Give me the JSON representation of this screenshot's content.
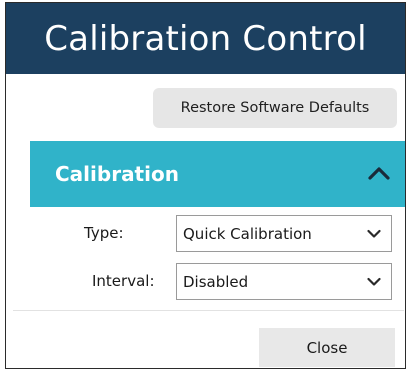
{
  "window": {
    "title": "Calibration Control"
  },
  "toolbar": {
    "restore_label": "Restore Software Defaults"
  },
  "calibration": {
    "header": "Calibration",
    "header_icon": "chevron-up-icon",
    "type_label": "Type:",
    "type_value": "Quick Calibration",
    "interval_label": "Interval:",
    "interval_value": "Disabled"
  },
  "footer": {
    "close_label": "Close"
  },
  "colors": {
    "title_bar": "#1c4060",
    "section_header": "#30b3c9",
    "button_bg": "#e6e6e6"
  }
}
